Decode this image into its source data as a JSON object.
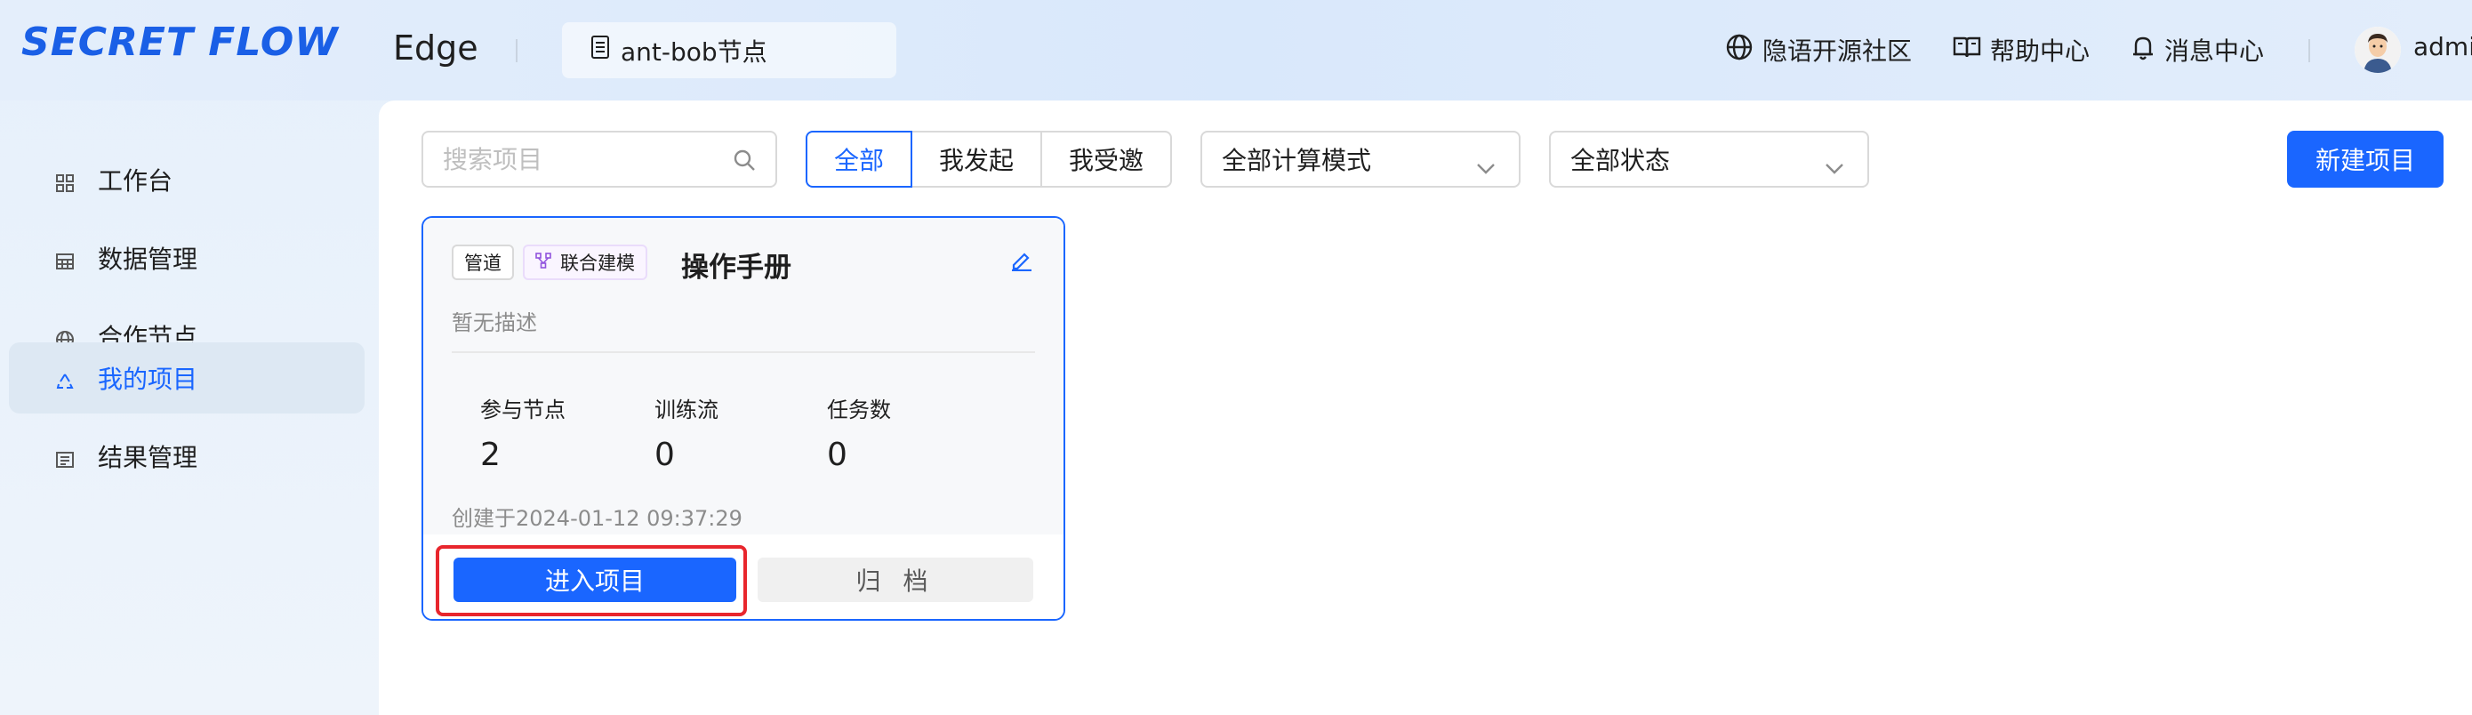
{
  "header": {
    "logo": "SECRET FLOW",
    "app_name": "Edge",
    "node_label": "ant-bob节点",
    "links": {
      "community": "隐语开源社区",
      "help": "帮助中心",
      "messages": "消息中心"
    },
    "user": "admi"
  },
  "sidebar": {
    "items": [
      {
        "label": "工作台",
        "icon": "dashboard-icon"
      },
      {
        "label": "数据管理",
        "icon": "table-icon"
      },
      {
        "label": "合作节点",
        "icon": "globe-icon"
      },
      {
        "label": "我的项目",
        "icon": "recycle-icon",
        "active": true
      },
      {
        "label": "结果管理",
        "icon": "list-icon"
      }
    ]
  },
  "toolbar": {
    "search_placeholder": "搜索项目",
    "filter_tabs": [
      "全部",
      "我发起",
      "我受邀"
    ],
    "active_tab": "全部",
    "compute_mode": "全部计算模式",
    "status": "全部状态",
    "new_project": "新建项目"
  },
  "project_card": {
    "tag_pipeline": "管道",
    "tag_mode": "联合建模",
    "title": "操作手册",
    "description": "暂无描述",
    "stats": [
      {
        "label": "参与节点",
        "value": "2"
      },
      {
        "label": "训练流",
        "value": "0"
      },
      {
        "label": "任务数",
        "value": "0"
      }
    ],
    "created": "创建于2024-01-12 09:37:29",
    "enter_label": "进入项目",
    "archive_label": "归 档"
  },
  "colors": {
    "primary": "#1a66ff",
    "highlight": "#e8262d"
  }
}
